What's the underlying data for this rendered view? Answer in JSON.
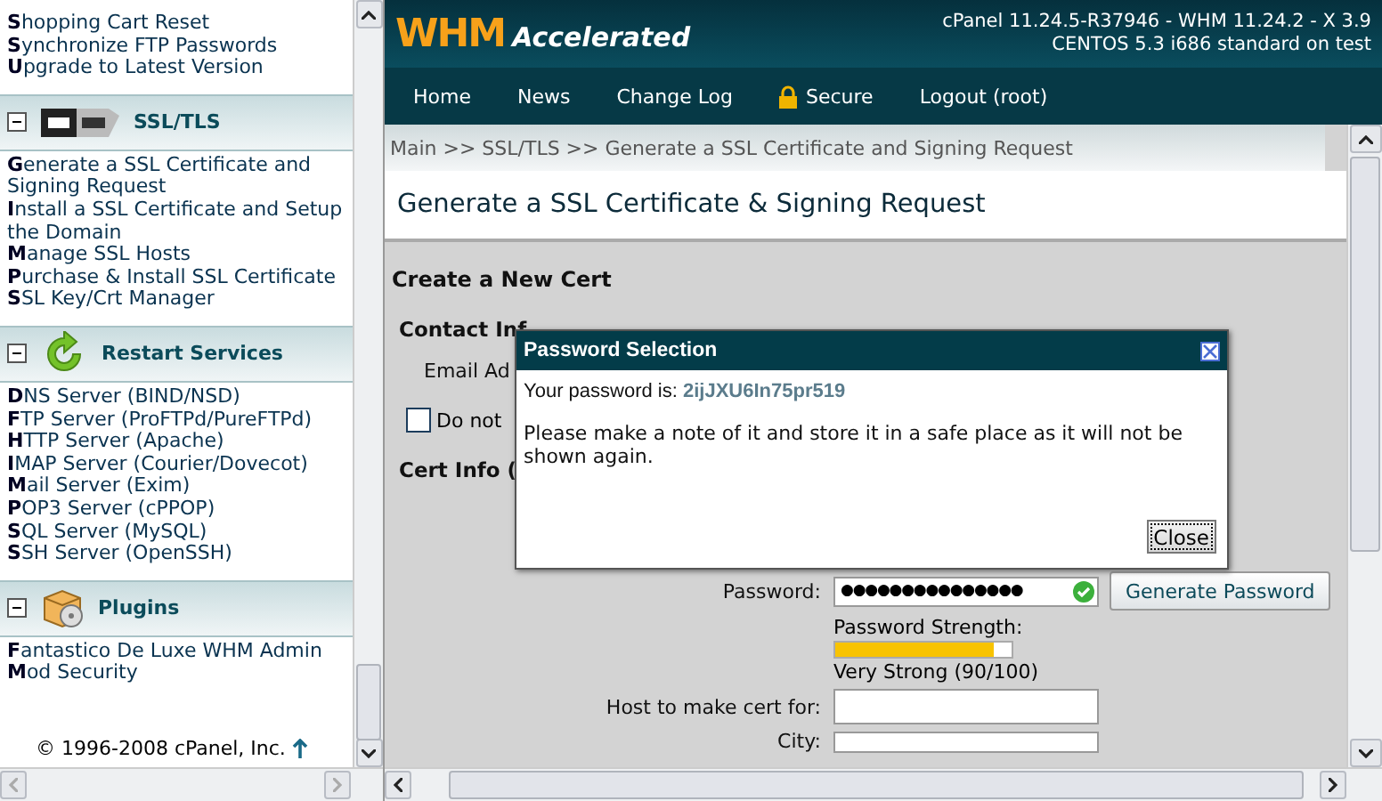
{
  "sidebar": {
    "groups": [
      {
        "items": [
          "**S**hopping Cart Reset",
          "**S**ynchronize FTP Passwords",
          "**U**pgrade to Latest Version"
        ]
      },
      {
        "title": "SSL/TLS",
        "expanded": true,
        "items": [
          "**G**enerate a SSL Certificate and Signing Request",
          "**I**nstall a SSL Certificate and Setup the Domain",
          "**M**anage SSL Hosts",
          "**P**urchase & Install SSL Certificate",
          "**S**SL Key/Crt Manager"
        ]
      },
      {
        "title": "Restart Services",
        "expanded": true,
        "items": [
          "**D**NS Server (BIND/NSD)",
          "**F**TP Server (ProFTPd/PureFTPd)",
          "**H**TTP Server (Apache)",
          "**I**MAP Server (Courier/Dovecot)",
          "**M**ail Server (Exim)",
          "**P**OP3 Server (cPPOP)",
          "**S**QL Server (MySQL)",
          "**S**SH Server (OpenSSH)"
        ]
      },
      {
        "title": "Plugins",
        "expanded": true,
        "items": [
          "**F**antastico De Luxe WHM Admin",
          "**M**od Security"
        ]
      }
    ],
    "footer": "© 1996-2008 cPanel, Inc."
  },
  "header": {
    "logo_main": "WHM",
    "logo_sub": "Accelerated",
    "version_lines": [
      "cPanel 11.24.5-R37946 - WHM 11.24.2 - X 3.9",
      "CENTOS 5.3 i686 standard on test"
    ]
  },
  "nav": [
    {
      "label": "Home",
      "locked": false
    },
    {
      "label": "News",
      "locked": false
    },
    {
      "label": "Change Log",
      "locked": false
    },
    {
      "label": "Secure",
      "locked": true
    },
    {
      "label": "Logout (root)",
      "locked": false
    }
  ],
  "breadcrumb": "Main >> SSL/TLS >> Generate a SSL Certificate and Signing Request",
  "page_title": "Generate a SSL Certificate & Signing Request",
  "form": {
    "heading": "Create a New Cert",
    "contact_heading": "Contact Inf",
    "email_label": "Email Ad",
    "checkbox": {
      "label": "Do not",
      "checked": false
    },
    "cert_heading": "Cert Info (",
    "password_label": "Password:",
    "password_value": "●●●●●●●●●●●●●●●",
    "password_valid": true,
    "generate_button": "Generate Password",
    "strength_label": "Password Strength:",
    "strength": {
      "level": 0.9
    },
    "strength_text": "Very Strong (90/100)",
    "host_label": "Host to make cert for:",
    "city_label": "City:"
  },
  "dialog": {
    "title": "Password Selection",
    "password_label": "Your password is:",
    "password": "2ijJXU6In75pr519",
    "message": "Please make a note of it and store it in a safe place as it will not be shown again.",
    "close_button": "Close"
  }
}
